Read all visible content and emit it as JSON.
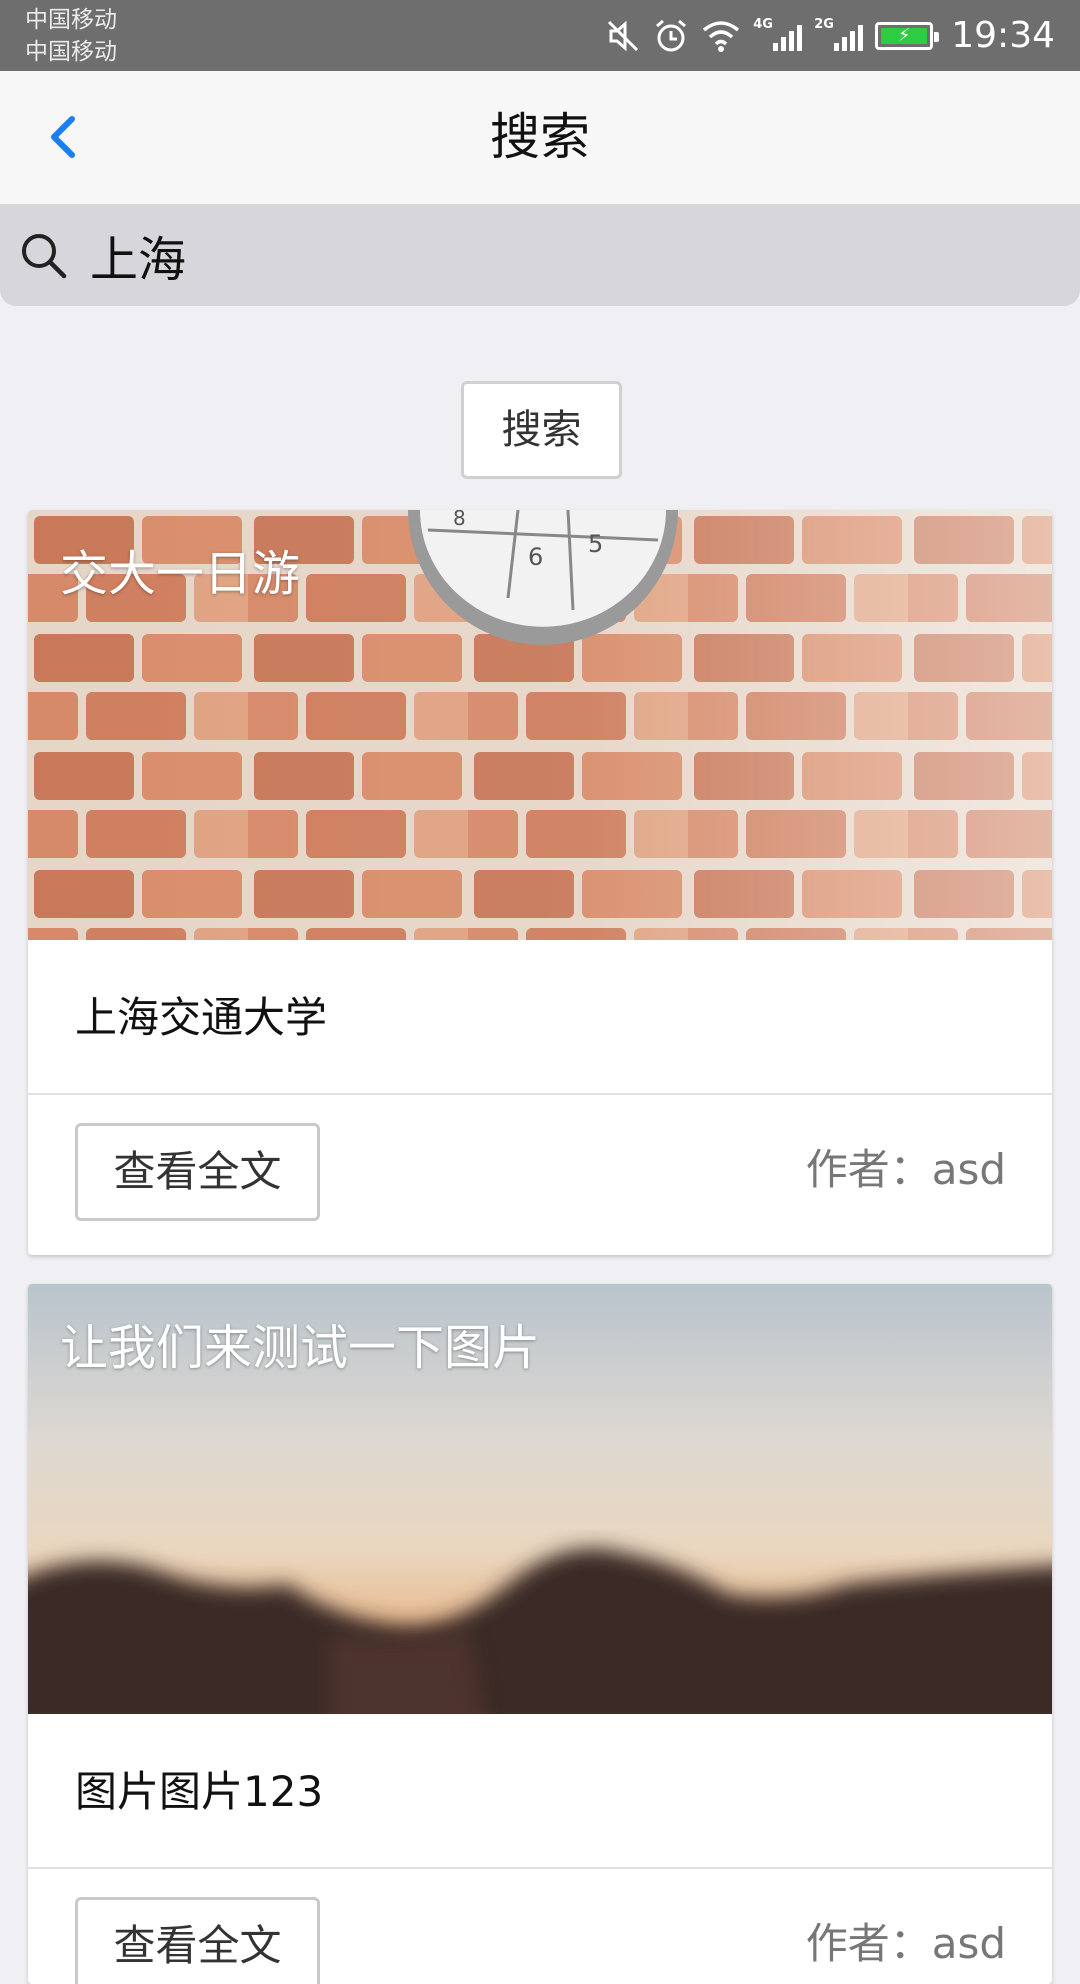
{
  "status_bar": {
    "carrier1": "中国移动",
    "carrier2": "中国移动",
    "network1": "4G",
    "network2": "2G",
    "time": "19:34",
    "icons": [
      "mute-icon",
      "alarm-icon",
      "wifi-icon",
      "signal-icon",
      "signal-icon",
      "battery-icon"
    ]
  },
  "nav": {
    "title": "搜索",
    "back_icon": "chevron-left-icon",
    "accent_color": "#1a7ef0"
  },
  "search": {
    "value": "上海",
    "button_label": "搜索"
  },
  "results": [
    {
      "image_title": "交大一日游",
      "content": "上海交通大学",
      "read_button": "查看全文",
      "author": "作者：asd"
    },
    {
      "image_title": "让我们来测试一下图片",
      "content": "图片图片123",
      "read_button": "查看全文",
      "author": "作者：asd"
    }
  ]
}
